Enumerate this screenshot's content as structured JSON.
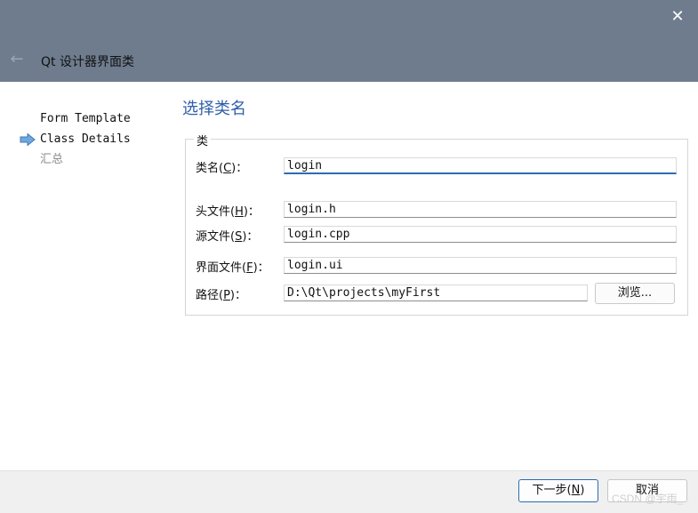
{
  "window": {
    "title": "Qt 设计器界面类",
    "close_glyph": "✕",
    "back_glyph": "←"
  },
  "steps": [
    {
      "label": "Form Template",
      "state": "done"
    },
    {
      "label": "Class Details",
      "state": "current"
    },
    {
      "label": "汇总",
      "state": "pending"
    }
  ],
  "page": {
    "heading": "选择类名",
    "group_title": "类"
  },
  "fields": {
    "class_name": {
      "label_pre": "类名(",
      "key": "C",
      "label_post": ")：",
      "value": "login"
    },
    "header_file": {
      "label_pre": "头文件(",
      "key": "H",
      "label_post": ")：",
      "value": "login.h"
    },
    "source_file": {
      "label_pre": "源文件(",
      "key": "S",
      "label_post": ")：",
      "value": "login.cpp"
    },
    "form_file": {
      "label_pre": "界面文件(",
      "key": "F",
      "label_post": ")：",
      "value": "login.ui"
    },
    "path": {
      "label_pre": "路径(",
      "key": "P",
      "label_post": ")：",
      "value": "D:\\Qt\\projects\\myFirst"
    }
  },
  "browse_label": "浏览...",
  "footer": {
    "next_pre": "下一步(",
    "next_key": "N",
    "next_post": ")",
    "cancel_label": "取消"
  },
  "watermark": "CSDN @宇雨_",
  "colors": {
    "titlebar": "#6e7c8e",
    "heading": "#2f5ea8",
    "accent": "#2b6cb0",
    "arrow": "#6fa8dc"
  }
}
